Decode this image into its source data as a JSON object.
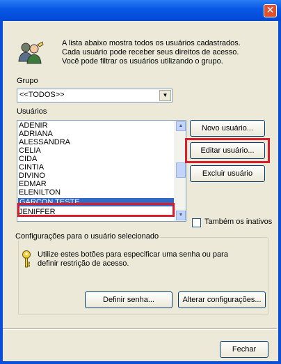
{
  "window": {
    "close_glyph": "✕"
  },
  "intro": {
    "icon": "users-access-icon",
    "lines": [
      "A lista abaixo mostra todos os usuários cadastrados.",
      "Cada usuário pode receber seus direitos de acesso.",
      "Você pode filtrar os usuários utilizando o grupo."
    ]
  },
  "group": {
    "label": "Grupo",
    "selected": "<<TODOS>>"
  },
  "users": {
    "label": "Usuários",
    "items": [
      "ADENIR",
      "ADRIANA",
      "ALESSANDRA",
      "CELIA",
      "CIDA",
      "CINTIA",
      "DIVINO",
      "EDMAR",
      "ELENILTON",
      "GARCON TESTE",
      "JENIFFER"
    ],
    "selected": "GARCON TESTE"
  },
  "buttons": {
    "new_user": "Novo usuário...",
    "edit_user": "Editar usuário...",
    "delete_user": "Excluir usuário",
    "set_password": "Definir senha...",
    "change_settings": "Alterar configurações...",
    "close": "Fechar"
  },
  "inactive": {
    "label": "Também os inativos",
    "checked": false
  },
  "settings_box": {
    "title": "Configurações para o usuário selecionado",
    "icon": "key-icon",
    "lines": [
      "Utilize estes botões para especificar uma senha ou para",
      "definir restrição de acesso."
    ]
  },
  "colors": {
    "titlebar": "#0a5ae6",
    "selection": "#316ac5",
    "highlight_red": "#d81d2c",
    "dialog_bg": "#ece9d8"
  }
}
